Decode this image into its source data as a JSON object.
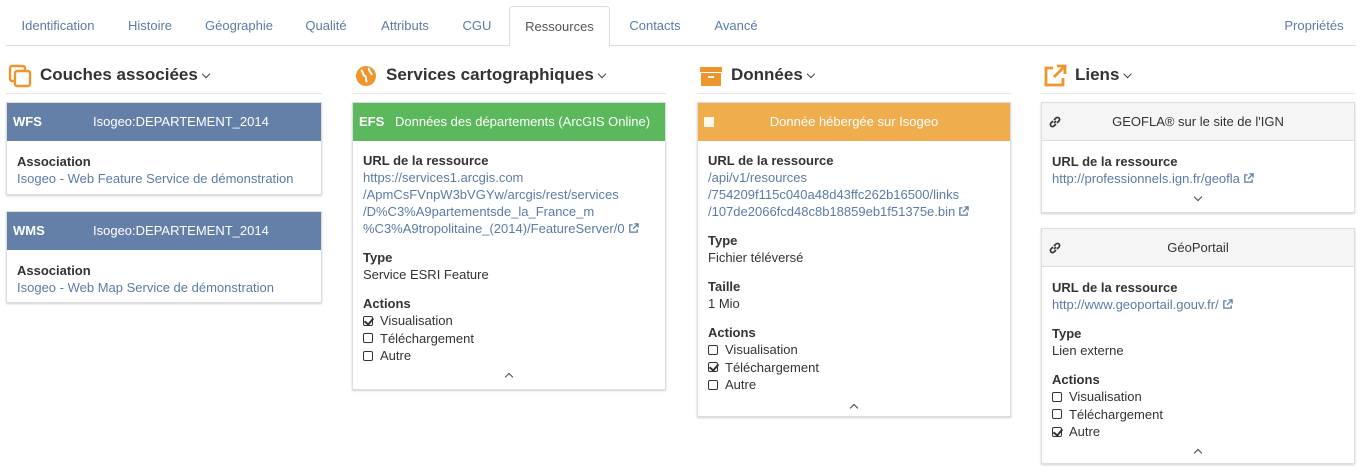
{
  "tabs": [
    {
      "label": "Identification"
    },
    {
      "label": "Histoire"
    },
    {
      "label": "Géographie"
    },
    {
      "label": "Qualité"
    },
    {
      "label": "Attributs"
    },
    {
      "label": "CGU"
    },
    {
      "label": "Ressources"
    },
    {
      "label": "Contacts"
    },
    {
      "label": "Avancé"
    }
  ],
  "properties_tab": "Propriétés",
  "colors": {
    "wxs_header": "#6580a8",
    "efs_header": "#5cb85c",
    "data_header": "#f0ad4e",
    "link": "#5b7ba6",
    "icon_orange": "#f0952c"
  },
  "layers": {
    "title": "Couches associées",
    "items": [
      {
        "code": "WFS",
        "name": "Isogeo:DEPARTEMENT_2014",
        "association_label": "Association",
        "association": "Isogeo - Web Feature Service de démonstration"
      },
      {
        "code": "WMS",
        "name": "Isogeo:DEPARTEMENT_2014",
        "association_label": "Association",
        "association": "Isogeo - Web Map Service de démonstration"
      }
    ]
  },
  "services": {
    "title": "Services cartographiques",
    "item": {
      "code": "EFS",
      "name": "Données des départements (ArcGIS Online)",
      "url_label": "URL de la ressource",
      "url_lines": [
        "https://services1.arcgis.com",
        "/ApmCsFVnpW3bVGYw/arcgis/rest/services",
        "/D%C3%A9partementsde_la_France_m",
        "%C3%A9tropolitaine_(2014)/FeatureServer/0"
      ],
      "type_label": "Type",
      "type": "Service ESRI Feature",
      "actions_label": "Actions",
      "actions": [
        {
          "label": "Visualisation",
          "checked": true
        },
        {
          "label": "Téléchargement",
          "checked": false
        },
        {
          "label": "Autre",
          "checked": false
        }
      ]
    }
  },
  "data": {
    "title": "Données",
    "item": {
      "name": "Donnée hébergée sur Isogeo",
      "url_label": "URL de la ressource",
      "url_lines": [
        "/api/v1/resources",
        "/754209f115c040a48d43ffc262b16500/links",
        "/107de2066fcd48c8b18859eb1f51375e.bin"
      ],
      "type_label": "Type",
      "type": "Fichier téléversé",
      "size_label": "Taille",
      "size": "1 Mio",
      "actions_label": "Actions",
      "actions": [
        {
          "label": "Visualisation",
          "checked": false
        },
        {
          "label": "Téléchargement",
          "checked": true
        },
        {
          "label": "Autre",
          "checked": false
        }
      ]
    }
  },
  "links": {
    "title": "Liens",
    "items": [
      {
        "name": "GEOFLA® sur le site de l'IGN",
        "url_label": "URL de la ressource",
        "url": "http://professionnels.ign.fr/geofla"
      },
      {
        "name": "GéoPortail",
        "url_label": "URL de la ressource",
        "url": "http://www.geoportail.gouv.fr/",
        "type_label": "Type",
        "type": "Lien externe",
        "actions_label": "Actions",
        "actions": [
          {
            "label": "Visualisation",
            "checked": false
          },
          {
            "label": "Téléchargement",
            "checked": false
          },
          {
            "label": "Autre",
            "checked": true
          }
        ]
      }
    ]
  }
}
